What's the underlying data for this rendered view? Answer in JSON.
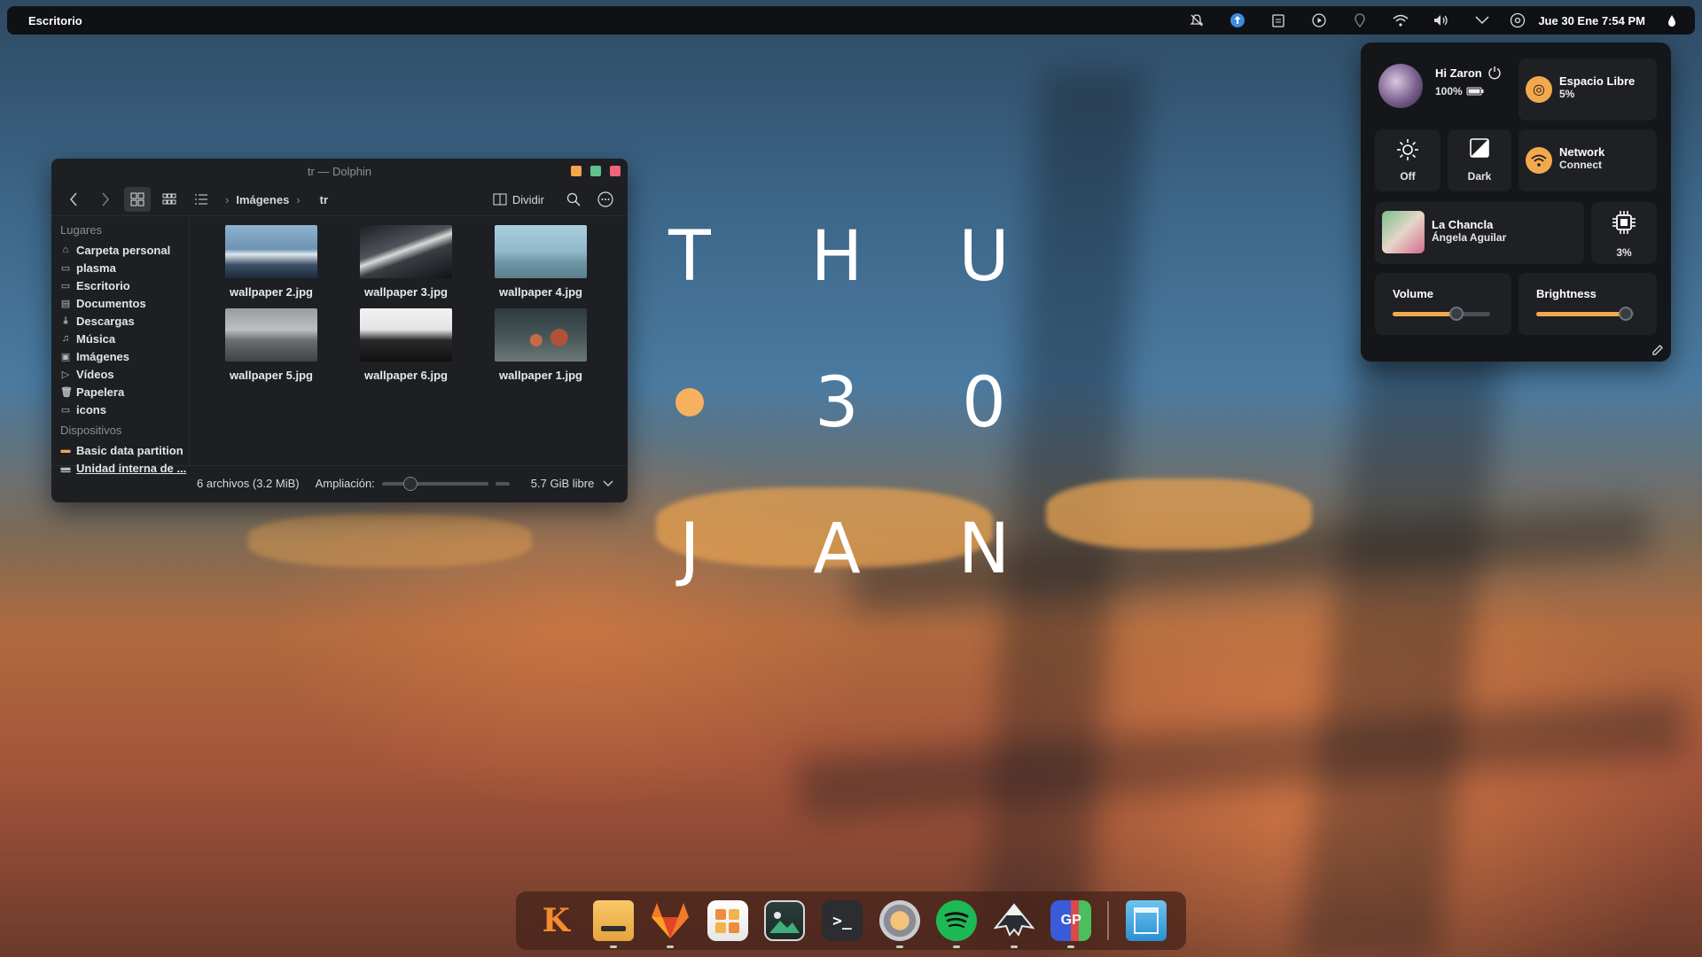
{
  "topbar": {
    "title": "Escritorio",
    "clock": "Jue 30 Ene  7:54 PM"
  },
  "dolphin": {
    "window_title": "tr — Dolphin",
    "breadcrumb": [
      "Imágenes",
      "tr"
    ],
    "split_label": "Dividir",
    "places_header": "Lugares",
    "places": [
      {
        "label": "Carpeta personal",
        "icon": "home-icon"
      },
      {
        "label": "plasma",
        "icon": "folder-icon"
      },
      {
        "label": "Escritorio",
        "icon": "desktop-icon"
      },
      {
        "label": "Documentos",
        "icon": "documents-icon"
      },
      {
        "label": "Descargas",
        "icon": "download-icon"
      },
      {
        "label": "Música",
        "icon": "music-icon"
      },
      {
        "label": "Imágenes",
        "icon": "images-icon"
      },
      {
        "label": "Vídeos",
        "icon": "video-icon"
      },
      {
        "label": "Papelera",
        "icon": "trash-icon"
      },
      {
        "label": "icons",
        "icon": "folder-icon"
      }
    ],
    "devices_header": "Dispositivos",
    "devices": [
      {
        "label": "Basic data partition",
        "icon": "drive-icon"
      },
      {
        "label": "Unidad interna de ...",
        "icon": "drive-icon"
      }
    ],
    "files": [
      {
        "name": "wallpaper 2.jpg"
      },
      {
        "name": "wallpaper 3.jpg"
      },
      {
        "name": "wallpaper 4.jpg"
      },
      {
        "name": "wallpaper 5.jpg"
      },
      {
        "name": "wallpaper 6.jpg"
      },
      {
        "name": "wallpaper 1.jpg"
      }
    ],
    "status_count": "6 archivos (3.2 MiB)",
    "zoom_label": "Ampliación:",
    "free_space": "5.7 GiB libre",
    "zoom_level": 0.2
  },
  "clock_widget": {
    "day": [
      "T",
      "H",
      "U"
    ],
    "date": [
      "3",
      "0"
    ],
    "month": [
      "J",
      "A",
      "N"
    ],
    "dot_color": "#f7b05e"
  },
  "panel": {
    "greeting": "Hi Zaron",
    "battery": "100%",
    "storage_title": "Espacio Libre",
    "storage_value": "5%",
    "night_light": "Off",
    "theme": "Dark",
    "network_title": "Network",
    "network_status": "Connect",
    "song_title": "La Chancla",
    "song_artist": "Ángela Aguilar",
    "cpu_value": "3%",
    "volume_label": "Volume",
    "brightness_label": "Brightness",
    "volume_level": 0.65,
    "brightness_level": 0.92,
    "accent": "#f2a94d"
  },
  "dock": {
    "apps": [
      {
        "name": "kde-launcher",
        "glyph": "K"
      },
      {
        "name": "files",
        "glyph": ""
      },
      {
        "name": "gitlab",
        "glyph": ""
      },
      {
        "name": "store",
        "glyph": ""
      },
      {
        "name": "image-viewer",
        "glyph": ""
      },
      {
        "name": "terminal",
        "glyph": ">_"
      },
      {
        "name": "settings",
        "glyph": ""
      },
      {
        "name": "spotify",
        "glyph": ""
      },
      {
        "name": "inkscape",
        "glyph": ""
      },
      {
        "name": "gparted",
        "glyph": "GP"
      },
      {
        "name": "window-manager",
        "glyph": ""
      }
    ]
  }
}
